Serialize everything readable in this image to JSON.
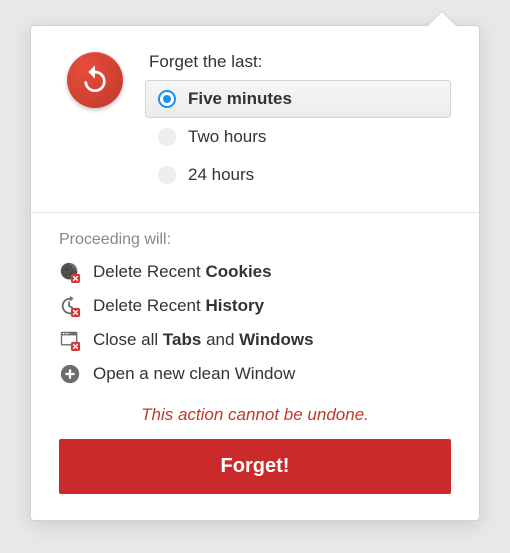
{
  "prompt": "Forget the last:",
  "options": [
    {
      "label": "Five minutes",
      "selected": true
    },
    {
      "label": "Two hours",
      "selected": false
    },
    {
      "label": "24 hours",
      "selected": false
    }
  ],
  "proceed_label": "Proceeding will:",
  "consequences": [
    {
      "prefix": "Delete Recent ",
      "bold1": "Cookies",
      "mid": "",
      "bold2": "",
      "icon": "cookie-x"
    },
    {
      "prefix": "Delete Recent ",
      "bold1": "History",
      "mid": "",
      "bold2": "",
      "icon": "history-x"
    },
    {
      "prefix": "Close all ",
      "bold1": "Tabs",
      "mid": " and ",
      "bold2": "Windows",
      "icon": "window-x"
    },
    {
      "prefix": "Open a new clean Window",
      "bold1": "",
      "mid": "",
      "bold2": "",
      "icon": "plus-circle"
    }
  ],
  "warning": "This action cannot be undone.",
  "button_label": "Forget!"
}
